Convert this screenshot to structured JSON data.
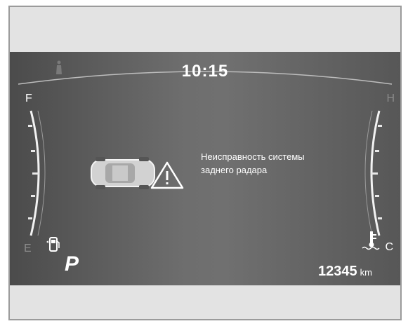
{
  "clock": {
    "time": "10:15"
  },
  "fuel_gauge": {
    "full_label": "F",
    "empty_label": "E",
    "icon": "fuel-pump-icon"
  },
  "temp_gauge": {
    "hot_label": "H",
    "cold_label": "C",
    "icon": "coolant-temperature-icon"
  },
  "gear": {
    "value": "P"
  },
  "odometer": {
    "value": "12345",
    "unit": "km"
  },
  "warning": {
    "icon": "car-rear-radar-warning-icon",
    "line1": "Неисправность системы",
    "line2": "заднего радара"
  },
  "colors": {
    "panel_dark": "#4b4b4b",
    "panel_light": "#707070",
    "text": "#ffffff"
  }
}
